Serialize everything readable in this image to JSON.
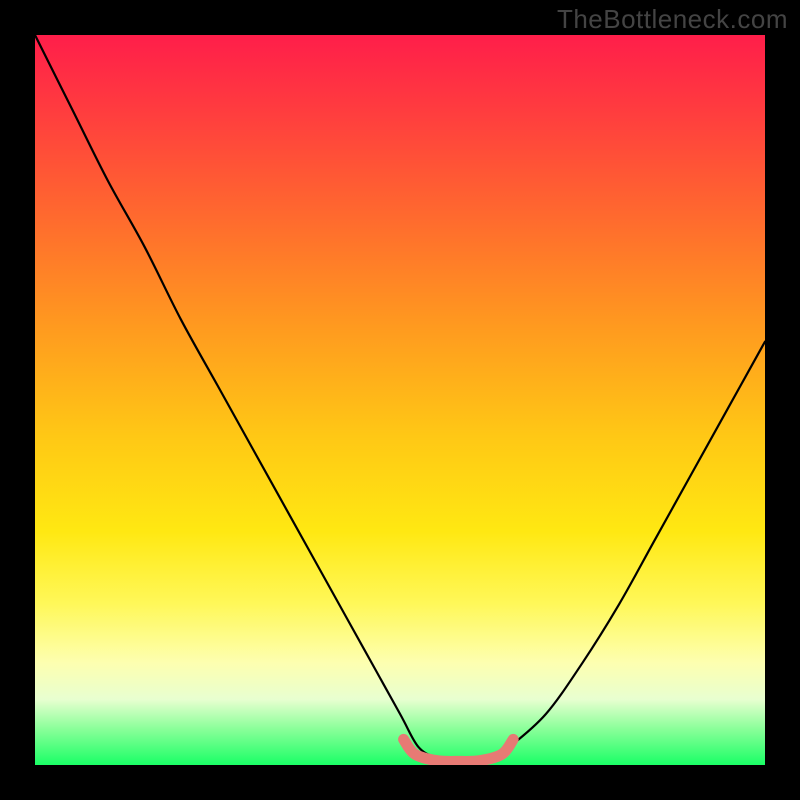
{
  "watermark": "TheBottleneck.com",
  "colors": {
    "frame": "#000000",
    "curve": "#000000",
    "highlight": "#e77a74",
    "watermark": "#444444"
  },
  "chart_data": {
    "type": "line",
    "title": "",
    "xlabel": "",
    "ylabel": "",
    "xlim": [
      0,
      1
    ],
    "ylim": [
      0,
      1
    ],
    "grid": false,
    "legend": null,
    "series": [
      {
        "name": "curve",
        "x": [
          0.0,
          0.05,
          0.1,
          0.15,
          0.2,
          0.25,
          0.3,
          0.35,
          0.4,
          0.45,
          0.5,
          0.525,
          0.55,
          0.575,
          0.6,
          0.625,
          0.65,
          0.7,
          0.75,
          0.8,
          0.85,
          0.9,
          0.95,
          1.0
        ],
        "y": [
          1.0,
          0.9,
          0.8,
          0.71,
          0.61,
          0.52,
          0.43,
          0.34,
          0.25,
          0.16,
          0.07,
          0.025,
          0.01,
          0.005,
          0.005,
          0.01,
          0.025,
          0.07,
          0.14,
          0.22,
          0.31,
          0.4,
          0.49,
          0.58
        ]
      },
      {
        "name": "bottom-highlight",
        "x": [
          0.505,
          0.52,
          0.55,
          0.58,
          0.61,
          0.64,
          0.655
        ],
        "y": [
          0.035,
          0.015,
          0.006,
          0.005,
          0.006,
          0.015,
          0.035
        ]
      }
    ],
    "gradient_stops": [
      {
        "pos": 0.0,
        "color": "#ff1e4a"
      },
      {
        "pos": 0.1,
        "color": "#ff3b3f"
      },
      {
        "pos": 0.25,
        "color": "#ff6a2e"
      },
      {
        "pos": 0.4,
        "color": "#ff9a1f"
      },
      {
        "pos": 0.55,
        "color": "#ffc815"
      },
      {
        "pos": 0.68,
        "color": "#ffe812"
      },
      {
        "pos": 0.78,
        "color": "#fff85a"
      },
      {
        "pos": 0.86,
        "color": "#fdffb0"
      },
      {
        "pos": 0.91,
        "color": "#e8ffd0"
      },
      {
        "pos": 0.95,
        "color": "#8bff9a"
      },
      {
        "pos": 1.0,
        "color": "#1aff66"
      }
    ]
  }
}
